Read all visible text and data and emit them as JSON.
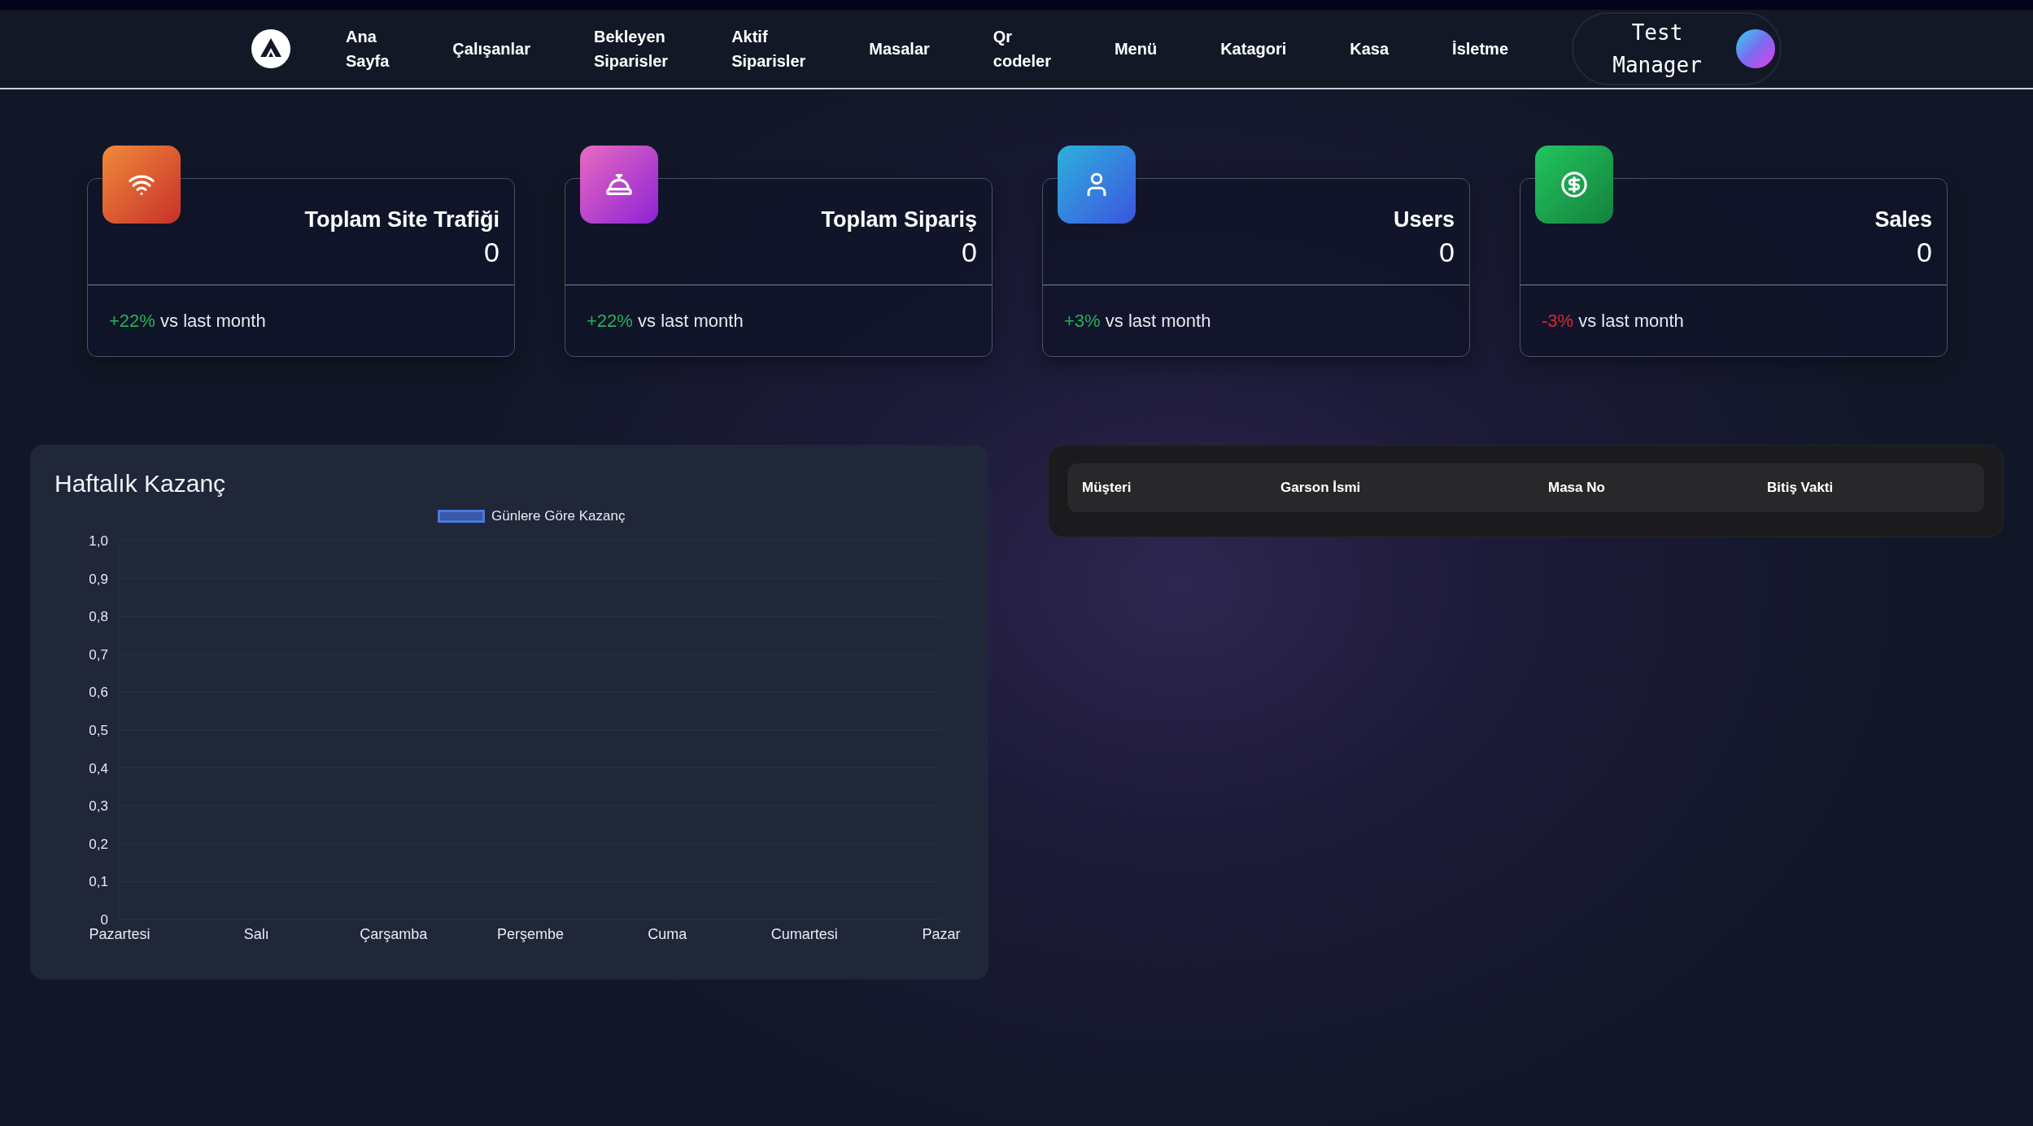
{
  "nav": {
    "items": [
      "Ana Sayfa",
      "Çalışanlar",
      "Bekleyen Siparisler",
      "Aktif Siparisler",
      "Masalar",
      "Qr codeler",
      "Menü",
      "Katagori",
      "Kasa",
      "İsletme"
    ]
  },
  "user": {
    "name": "Test Manager"
  },
  "stats": [
    {
      "kind": "traffic",
      "title": "Toplam Site Trafiği",
      "value": "0",
      "change": "+22%",
      "color": "#22b455",
      "note": "vs last month"
    },
    {
      "kind": "orders",
      "title": "Toplam Sipariş",
      "value": "0",
      "change": "+22%",
      "color": "#22b455",
      "note": "vs last month"
    },
    {
      "kind": "users",
      "title": "Users",
      "value": "0",
      "change": "+3%",
      "color": "#22b455",
      "note": "vs last month"
    },
    {
      "kind": "sales",
      "title": "Sales",
      "value": "0",
      "change": "-3%",
      "color": "#e3262e",
      "note": "vs last month"
    }
  ],
  "chart_panel": {
    "title": "Haftalık Kazanç",
    "chart_data": {
      "type": "bar",
      "categories": [
        "Pazartesi",
        "Salı",
        "Çarşamba",
        "Perşembe",
        "Cuma",
        "Cumartesi",
        "Pazar"
      ],
      "series": [
        {
          "name": "Günlere Göre Kazanç",
          "color": "#4a78e0",
          "values": [
            0,
            0,
            0,
            0,
            0,
            0,
            0
          ]
        }
      ],
      "ylim": [
        0,
        1
      ],
      "grid": true,
      "yticks": [
        {
          "value": 0,
          "label": "0"
        },
        {
          "value": 0.1,
          "label": "0,1"
        },
        {
          "value": 0.2,
          "label": "0,2"
        },
        {
          "value": 0.3,
          "label": "0,3"
        },
        {
          "value": 0.4,
          "label": "0,4"
        },
        {
          "value": 0.5,
          "label": "0,5"
        },
        {
          "value": 0.6,
          "label": "0,6"
        },
        {
          "value": 0.7,
          "label": "0,7"
        },
        {
          "value": 0.8,
          "label": "0,8"
        },
        {
          "value": 0.9,
          "label": "0,9"
        },
        {
          "value": 1,
          "label": "1,0"
        }
      ]
    }
  },
  "orders_table": {
    "columns": [
      "Müşteri",
      "Garson İsmi",
      "Masa No",
      "Bitiş Vakti"
    ]
  }
}
